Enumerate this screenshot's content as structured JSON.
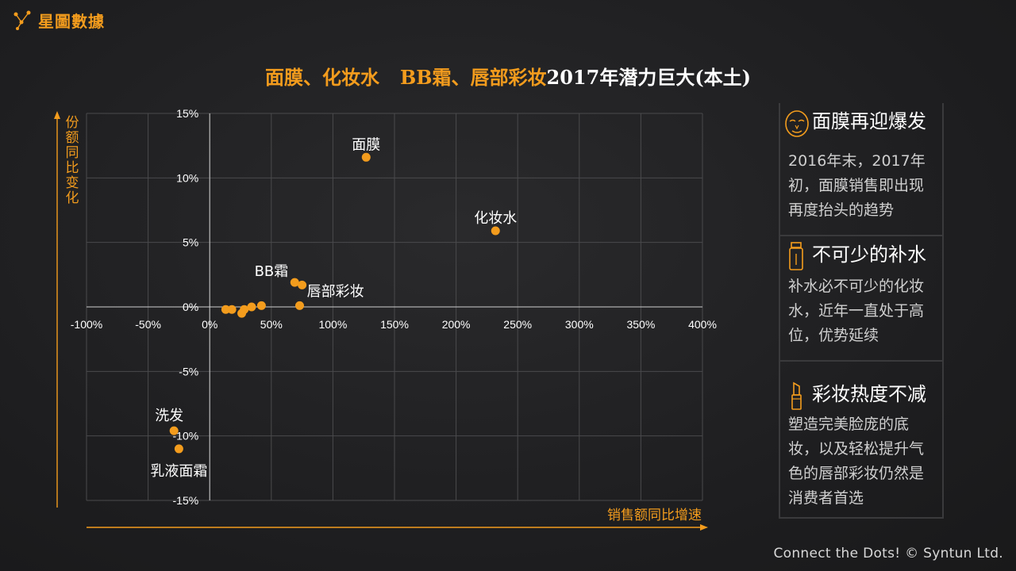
{
  "brand": {
    "name": "星圖數據"
  },
  "title": {
    "part1": "面膜、化妆水",
    "part2": "BB霜、唇部彩妆",
    "part3": "2017年潜力巨大(本土)"
  },
  "chart_data": {
    "type": "scatter",
    "xlabel": "销售额同比增速",
    "ylabel": "份额同比变化",
    "xlim": [
      -100,
      400
    ],
    "ylim": [
      -15,
      15
    ],
    "x_ticks": [
      -100,
      -50,
      0,
      50,
      100,
      150,
      200,
      250,
      300,
      350,
      400
    ],
    "y_ticks": [
      -15,
      -10,
      -5,
      0,
      5,
      10,
      15
    ],
    "x_tick_labels": [
      "-100%",
      "-50%",
      "0%",
      "50%",
      "100%",
      "150%",
      "200%",
      "250%",
      "300%",
      "350%",
      "400%"
    ],
    "y_tick_labels": [
      "-15%",
      "-10%",
      "-5%",
      "0%",
      "5%",
      "10%",
      "15%"
    ],
    "grid": true,
    "color": "#f39c1d",
    "points": [
      {
        "x": 127,
        "y": 11.6,
        "label": "面膜",
        "label_pos": "above"
      },
      {
        "x": 232,
        "y": 5.9,
        "label": "化妆水",
        "label_pos": "above"
      },
      {
        "x": 69,
        "y": 1.9,
        "label": "BB霜",
        "label_pos": "upper-left"
      },
      {
        "x": 75,
        "y": 1.7,
        "label": "唇部彩妆",
        "label_pos": "lower-right"
      },
      {
        "x": 73,
        "y": 0.1,
        "label": ""
      },
      {
        "x": 42,
        "y": 0.1,
        "label": ""
      },
      {
        "x": 34,
        "y": 0.0,
        "label": ""
      },
      {
        "x": 28,
        "y": -0.2,
        "label": ""
      },
      {
        "x": 26,
        "y": -0.5,
        "label": ""
      },
      {
        "x": 18,
        "y": -0.2,
        "label": ""
      },
      {
        "x": 13,
        "y": -0.2,
        "label": ""
      },
      {
        "x": -29,
        "y": -9.6,
        "label": "洗发",
        "label_pos": "upper-left"
      },
      {
        "x": -25,
        "y": -11.0,
        "label": "乳液面霜",
        "label_pos": "below"
      }
    ]
  },
  "panels": [
    {
      "icon": "face-mask-icon",
      "title": "面膜再迎爆发",
      "text": "2016年末，2017年初，面膜销售即出现再度抬头的趋势"
    },
    {
      "icon": "toner-bottle-icon",
      "title": "不可少的补水",
      "text": "补水必不可少的化妆水，近年一直处于高位，优势延续"
    },
    {
      "icon": "lipstick-icon",
      "title": "彩妆热度不减",
      "text": "塑造完美脸庞的底妆，以及轻松提升气色的唇部彩妆仍然是消费者首选"
    }
  ],
  "footer": {
    "text": "Connect the Dots! © Syntun Ltd."
  }
}
